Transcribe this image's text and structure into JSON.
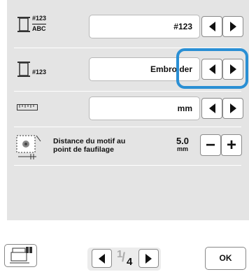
{
  "rows": {
    "thread_number": {
      "icon_top": "#123",
      "icon_bottom": "ABC",
      "value": "#123"
    },
    "thread_brand": {
      "icon_label": "#123",
      "value": "Embroider"
    },
    "measurement": {
      "value": "mm"
    },
    "baste_distance": {
      "label_line1": "Distance du motif au",
      "label_line2": "point de faufilage",
      "value": "5.0",
      "unit": "mm",
      "minus": "−",
      "plus": "+"
    }
  },
  "footer": {
    "page_current": "1",
    "page_total": "4",
    "ok_label": "OK"
  },
  "colors": {
    "panel": "#e4e4e4",
    "highlight": "#2a8fd4"
  }
}
